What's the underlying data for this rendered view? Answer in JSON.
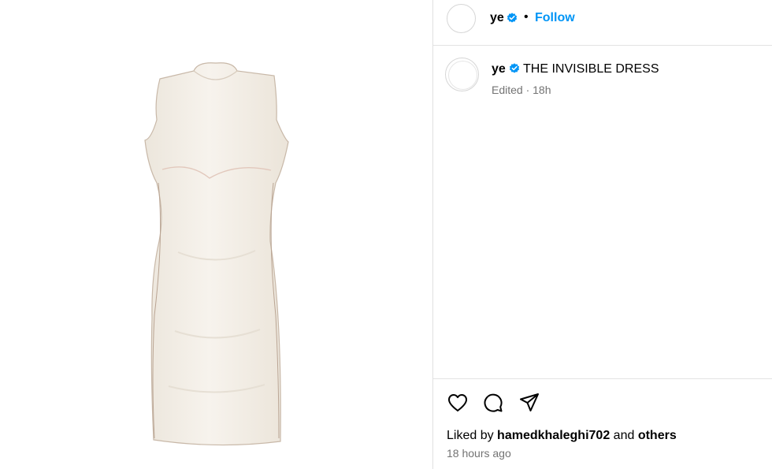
{
  "post": {
    "header": {
      "username": "ye",
      "separator": "•",
      "follow_label": "Follow"
    },
    "caption": {
      "username": "ye",
      "text": "THE INVISIBLE DRESS",
      "meta": "Edited · 18h"
    },
    "likes": {
      "prefix": "Liked by",
      "user": "hamedkhaleghi702",
      "connector": "and",
      "others": "others"
    },
    "timestamp": "18 hours ago"
  },
  "icons": {
    "verified": "verified-badge-icon",
    "like": "heart-icon",
    "comment": "comment-bubble-icon",
    "share": "paper-plane-icon"
  },
  "colors": {
    "accent": "#0095f6",
    "verified": "#0095f6",
    "muted_text": "#737373",
    "dress": "#f3eee6"
  }
}
